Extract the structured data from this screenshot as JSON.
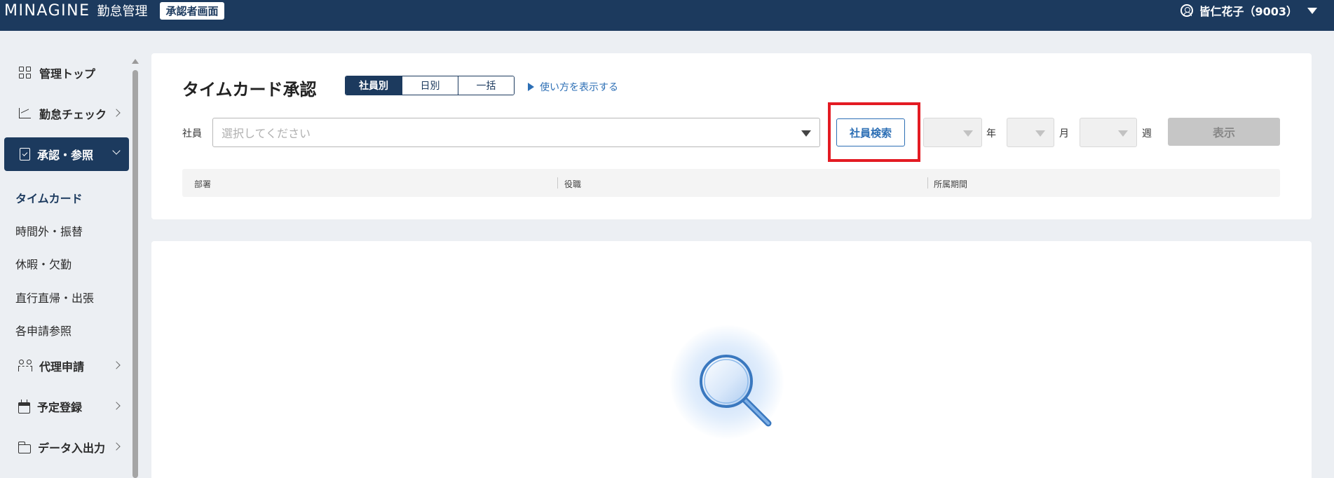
{
  "header": {
    "logo": "MINAGINE",
    "product": "勤怠管理",
    "badge": "承認者画面",
    "user": "皆仁花子（9003）"
  },
  "sidebar": {
    "items": [
      {
        "label": "管理トップ",
        "icon": "grid-icon"
      },
      {
        "label": "勤怠チェック",
        "icon": "chart-icon"
      },
      {
        "label": "承認・参照",
        "icon": "document-check-icon",
        "active": true
      },
      {
        "label": "代理申請",
        "icon": "people-icon"
      },
      {
        "label": "予定登録",
        "icon": "calendar-icon"
      },
      {
        "label": "データ入出力",
        "icon": "folder-icon"
      }
    ],
    "sub_items": [
      "タイムカード",
      "時間外・振替",
      "休暇・欠勤",
      "直行直帰・出張",
      "各申請参照"
    ]
  },
  "main": {
    "title": "タイムカード承認",
    "segments": [
      "社員別",
      "日別",
      "一括"
    ],
    "active_segment": "社員別",
    "howto_link": "使い方を表示する",
    "employee_label": "社員",
    "employee_placeholder": "選択してください",
    "search_button": "社員検索",
    "year_unit": "年",
    "month_unit": "月",
    "week_unit": "週",
    "show_button": "表示",
    "info_columns": [
      "部署",
      "役職",
      "所属期間"
    ]
  },
  "colors": {
    "header": "#1c3a5e",
    "link": "#2d6fb5",
    "highlight": "#e31b23"
  }
}
